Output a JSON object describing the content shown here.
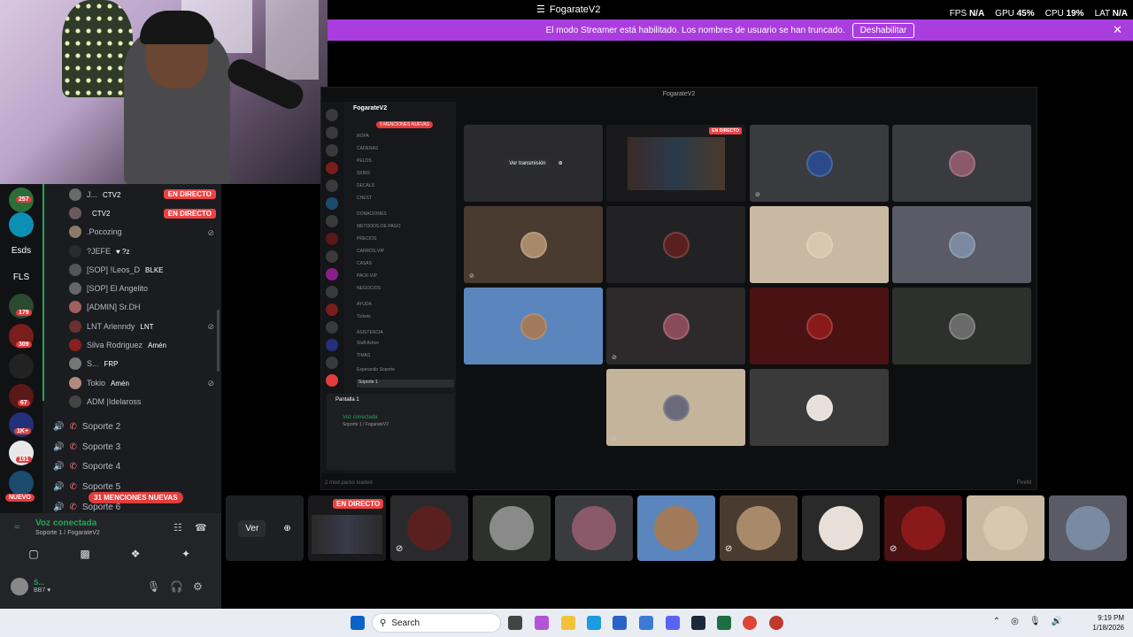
{
  "titlebar": {
    "app_title": "FogarateV2",
    "fps_label": "FPS",
    "fps_value": "N/A",
    "gpu_label": "GPU",
    "gpu_value": "45%",
    "cpu_label": "CPU",
    "cpu_value": "19%",
    "lat_label": "LAT",
    "lat_value": "N/A"
  },
  "streamer_bar": {
    "message": "El modo Streamer está habilitado. Los nombres de usuario se han truncado.",
    "button": "Deshabilitar"
  },
  "rail": {
    "badges": [
      "257",
      "179",
      "309",
      "67",
      "1K+",
      "191"
    ],
    "labels": [
      "Esds",
      "FLS"
    ],
    "new_label": "NUEVO"
  },
  "members": [
    {
      "name": "J...",
      "tag": "CTV2",
      "live": "EN DIRECTO"
    },
    {
      "name": "",
      "tag": "CTV2",
      "live": "EN DIRECTO"
    },
    {
      "name": ".Pocozing",
      "tag": ""
    },
    {
      "name": "?JEFE",
      "tag": "♥ ?z"
    },
    {
      "name": "[SOP] !Leos_D",
      "tag": "BLKE"
    },
    {
      "name": "[SOP] El Angelito",
      "tag": ""
    },
    {
      "name": "[ADMIN] Sr.DH",
      "tag": ""
    },
    {
      "name": "LNT Arlenndy",
      "tag": "LNT"
    },
    {
      "name": "Silva Rodriguez",
      "tag": "Amén"
    },
    {
      "name": "S...",
      "tag": "FRP"
    },
    {
      "name": "Tokio",
      "tag": "Amén"
    },
    {
      "name": "ADM |Idelaross",
      "tag": ""
    }
  ],
  "voice_channels": [
    "Soporte 2",
    "Soporte 3",
    "Soporte 4",
    "Soporte 5",
    "Soporte 6"
  ],
  "mentions_badge": "31 MENCIONES NUEVAS",
  "voice_panel": {
    "title": "Voz conectada",
    "subtitle": "Soporte 1 / FogarateV2",
    "user_name": "S...",
    "user_status": "BB7 ♥"
  },
  "inner": {
    "window_title": "FogarateV2",
    "server_name": "FogarateV2",
    "mention_badge": "9 MENCIONES NUEVAS",
    "channels": [
      "ROPA",
      "CADENAS",
      "PELOS",
      "SKINS",
      "DECALS",
      "CHEST",
      "DONACIONES",
      "METODOS-DE-PAGO",
      "PRECIOS",
      "CARROS-VIP",
      "CASAS",
      "PACK-VIP",
      "NEGOCIOS",
      "AYUDA",
      "Tickets",
      "ASISTENCIA",
      "Staff Activo",
      "TIMAS",
      "Esperando Soporte",
      "Soporte 1"
    ],
    "screen_label": "Pantalla 1",
    "voice_connected": "Voz conectada",
    "voice_sub": "Soporte 1 / FogarateV2",
    "watch_label": "Ver transmisión",
    "live_label": "EN DIRECTO",
    "log_left": "2 mod packs loaded",
    "log_right": "FiveM"
  },
  "strip": {
    "ver_label": "Ver",
    "live_label": "EN DIRECTO"
  },
  "taskbar": {
    "search_label": "Search",
    "time": "9:19 PM",
    "date": "1/18/2026"
  },
  "colors": {
    "streamer_bar": "#a93dde",
    "live_red": "#ed4245",
    "voice_green": "#23a55a"
  }
}
